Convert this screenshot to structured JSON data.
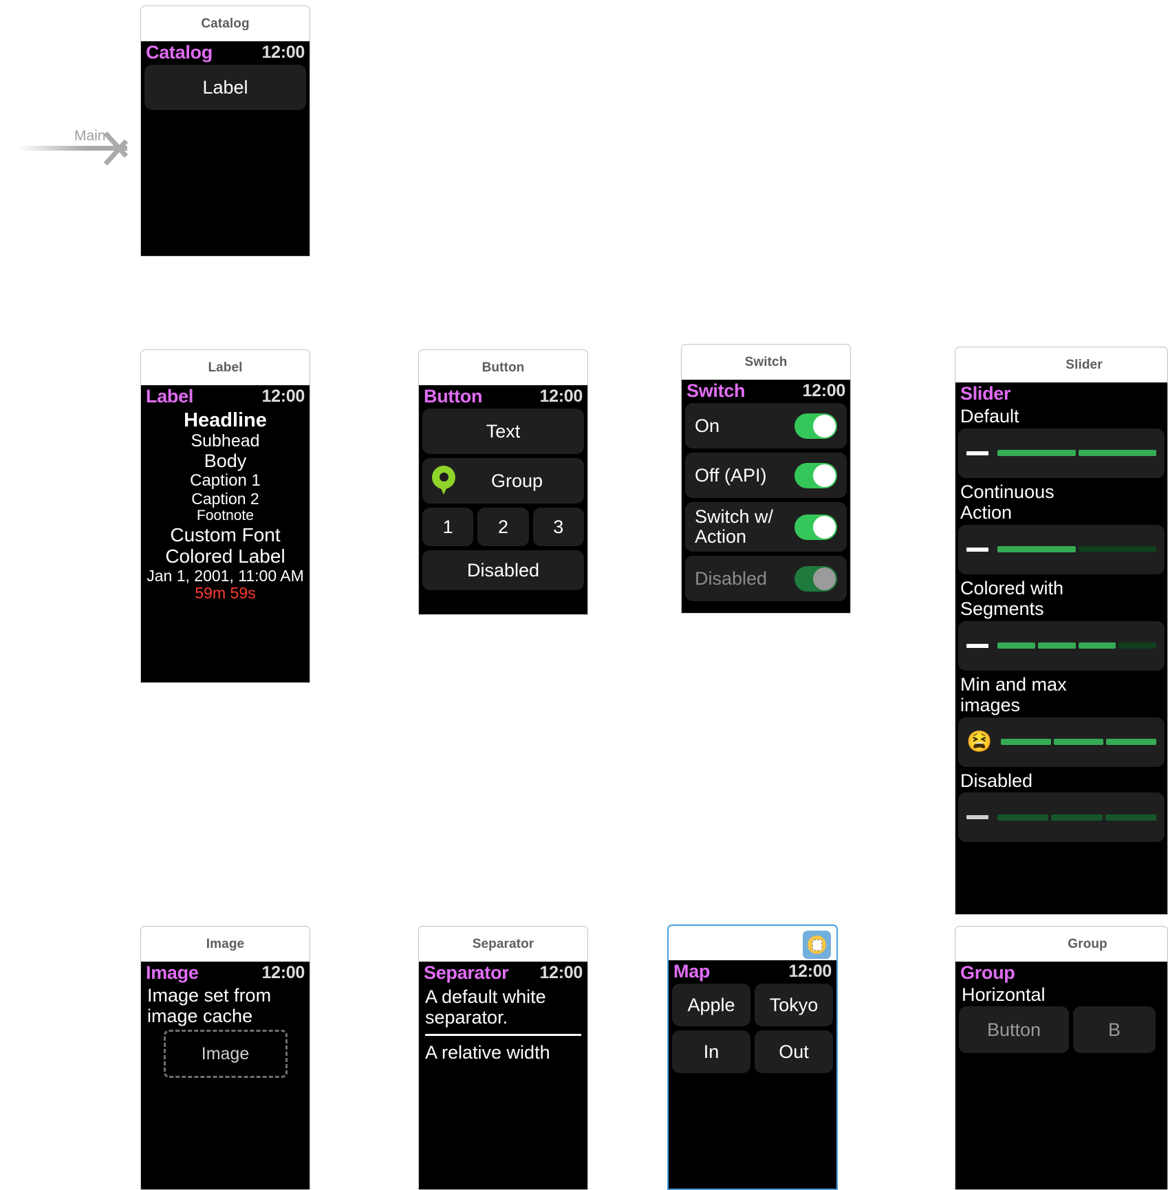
{
  "canvas": {
    "entry_point_label": "Main"
  },
  "scenes": [
    {
      "id": "catalog",
      "chrome_title": "Catalog",
      "status_title": "Catalog",
      "status_time": "12:00",
      "rows": [
        {
          "label": "Label"
        }
      ]
    },
    {
      "id": "label",
      "chrome_title": "Label",
      "status_title": "Label",
      "status_time": "12:00",
      "lines": [
        {
          "text": "Headline",
          "style": "headline"
        },
        {
          "text": "Subhead",
          "style": "subhead"
        },
        {
          "text": "Body",
          "style": "body"
        },
        {
          "text": "Caption 1",
          "style": "caption1"
        },
        {
          "text": "Caption 2",
          "style": "caption2"
        },
        {
          "text": "Footnote",
          "style": "footnote"
        },
        {
          "text": "Custom Font",
          "style": "custom"
        },
        {
          "text": "Colored Label",
          "style": "colored"
        },
        {
          "text": "Jan 1, 2001, 11:00 AM",
          "style": "date"
        },
        {
          "text": "59m 59s",
          "style": "timer",
          "color": "#ff3b30"
        }
      ]
    },
    {
      "id": "button",
      "chrome_title": "Button",
      "status_title": "Button",
      "status_time": "12:00",
      "buttons": {
        "text": "Text",
        "group": "Group",
        "group_icon": "map-pin-icon",
        "numbers": [
          "1",
          "2",
          "3"
        ],
        "disabled": "Disabled"
      }
    },
    {
      "id": "switch",
      "chrome_title": "Switch",
      "status_title": "Switch",
      "status_time": "12:00",
      "switches": [
        {
          "label": "On",
          "state": "on",
          "disabled": false
        },
        {
          "label": "Off (API)",
          "state": "on",
          "disabled": false
        },
        {
          "label": "Switch w/\nAction",
          "state": "on",
          "disabled": false
        },
        {
          "label": "Disabled",
          "state": "disabled",
          "disabled": true
        }
      ]
    },
    {
      "id": "slider",
      "chrome_title": "Slider",
      "status_title": "Slider",
      "status_time": "12:00",
      "sliders": [
        {
          "caption": "Default",
          "left_glyph": "minus-glyph",
          "segments": 2,
          "filled": 2,
          "disabled": false
        },
        {
          "caption": "Continuous\nAction",
          "left_glyph": "minus-glyph",
          "segments": 2,
          "filled": 1,
          "disabled": false
        },
        {
          "caption": "Colored with\nSegments",
          "left_glyph": "minus-glyph",
          "segments": 4,
          "filled": 3,
          "disabled": false
        },
        {
          "caption": "Min and max\nimages",
          "left_glyph": "emoji-tired-face",
          "segments": 3,
          "filled": 3,
          "disabled": false
        },
        {
          "caption": "Disabled",
          "left_glyph": "minus-glyph",
          "segments": 3,
          "filled": 0,
          "disabled": true
        }
      ]
    },
    {
      "id": "image",
      "chrome_title": "Image",
      "status_title": "Image",
      "status_time": "12:00",
      "body_text": "Image set from\nimage cache",
      "placeholder_label": "Image"
    },
    {
      "id": "separator",
      "chrome_title": "Separator",
      "status_title": "Separator",
      "status_time": "12:00",
      "texts": [
        "A default white\nseparator.",
        "A relative width"
      ]
    },
    {
      "id": "map",
      "chrome_title": "",
      "selected": true,
      "scene_icon": "watch-scene-icon",
      "status_title": "Map",
      "status_time": "12:00",
      "buttons": [
        [
          "Apple",
          "Tokyo"
        ],
        [
          "In",
          "Out"
        ]
      ]
    },
    {
      "id": "group",
      "chrome_title": "Group",
      "status_title": "Group",
      "status_time": "12:00",
      "caption": "Horizontal",
      "buttons": [
        "Button",
        "B"
      ]
    }
  ],
  "colors": {
    "status_title": "#e26df5",
    "status_time": "#dcdcdc",
    "row_background": "#1f1f1f",
    "screen_background": "#000000",
    "toggle_on": "#35c759",
    "toggle_disabled": "#1f7a3d",
    "slider_fill": "#35ab55",
    "slider_empty": "#103d1c",
    "timer_red": "#ff3b30",
    "pin_green": "#8fd42a",
    "selection_blue": "#4a9fe0",
    "chrome_title": "#5d5d5d",
    "entry_arrow": "#aaaaaa"
  }
}
